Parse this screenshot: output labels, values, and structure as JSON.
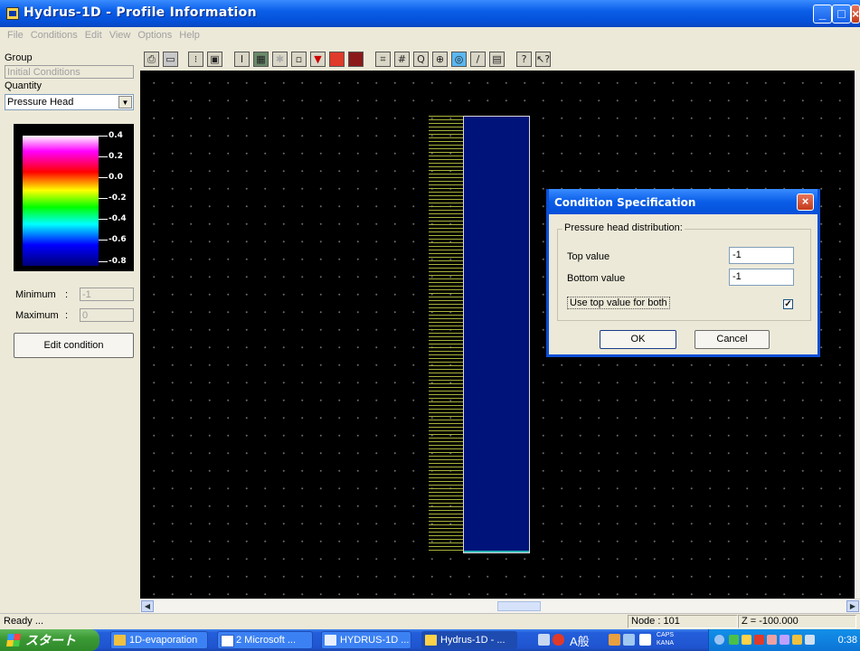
{
  "window": {
    "title": "Hydrus-1D - Profile Information"
  },
  "menu": [
    "File",
    "Conditions",
    "Edit",
    "View",
    "Options",
    "Help"
  ],
  "left_panel": {
    "group_label": "Group",
    "group_value": "Initial Conditions",
    "quantity_label": "Quantity",
    "quantity_value": "Pressure Head",
    "legend_ticks": [
      "0.4",
      "0.2",
      "0.0",
      "-0.2",
      "-0.4",
      "-0.6",
      "-0.8"
    ],
    "minimum_label": "Minimum",
    "minimum_value": "-1",
    "maximum_label": "Maximum",
    "maximum_value": "0",
    "sep": ":",
    "edit_button": "Edit condition"
  },
  "toolbar": {
    "icons": [
      "print-icon",
      "save-icon",
      "grid-dots-icon",
      "zoom-window-icon",
      "column-icon",
      "fill-icon",
      "observation-icon",
      "node-icon",
      "pressure-icon",
      "material-icon",
      "layer-icon",
      "fit-icon",
      "grid-icon",
      "zoom-icon",
      "zoom-in-icon",
      "refresh-icon",
      "pen-icon",
      "chart-icon",
      "help-icon",
      "context-help-icon"
    ]
  },
  "dialog": {
    "title": "Condition Specification",
    "group_title": "Pressure head distribution:",
    "top_label": "Top value",
    "top_value": "-1",
    "bottom_label": "Bottom value",
    "bottom_value": "-1",
    "use_top_label": "Use top value for both",
    "use_top_checked": true,
    "ok": "OK",
    "cancel": "Cancel"
  },
  "status": {
    "text": "Ready ...",
    "node": "Node : 101",
    "z": "Z = -100.000"
  },
  "taskbar": {
    "start": "スタート",
    "tasks": [
      "1D-evaporation",
      "2 Microsoft ...",
      "HYDRUS-1D ...",
      "Hydrus-1D - ..."
    ],
    "clock": "0:38",
    "ime": "A般",
    "caps": "CAPS",
    "kana": "KANA"
  },
  "colors": {
    "profile_fill": "#00137a",
    "accent": "#0a5ee8"
  }
}
